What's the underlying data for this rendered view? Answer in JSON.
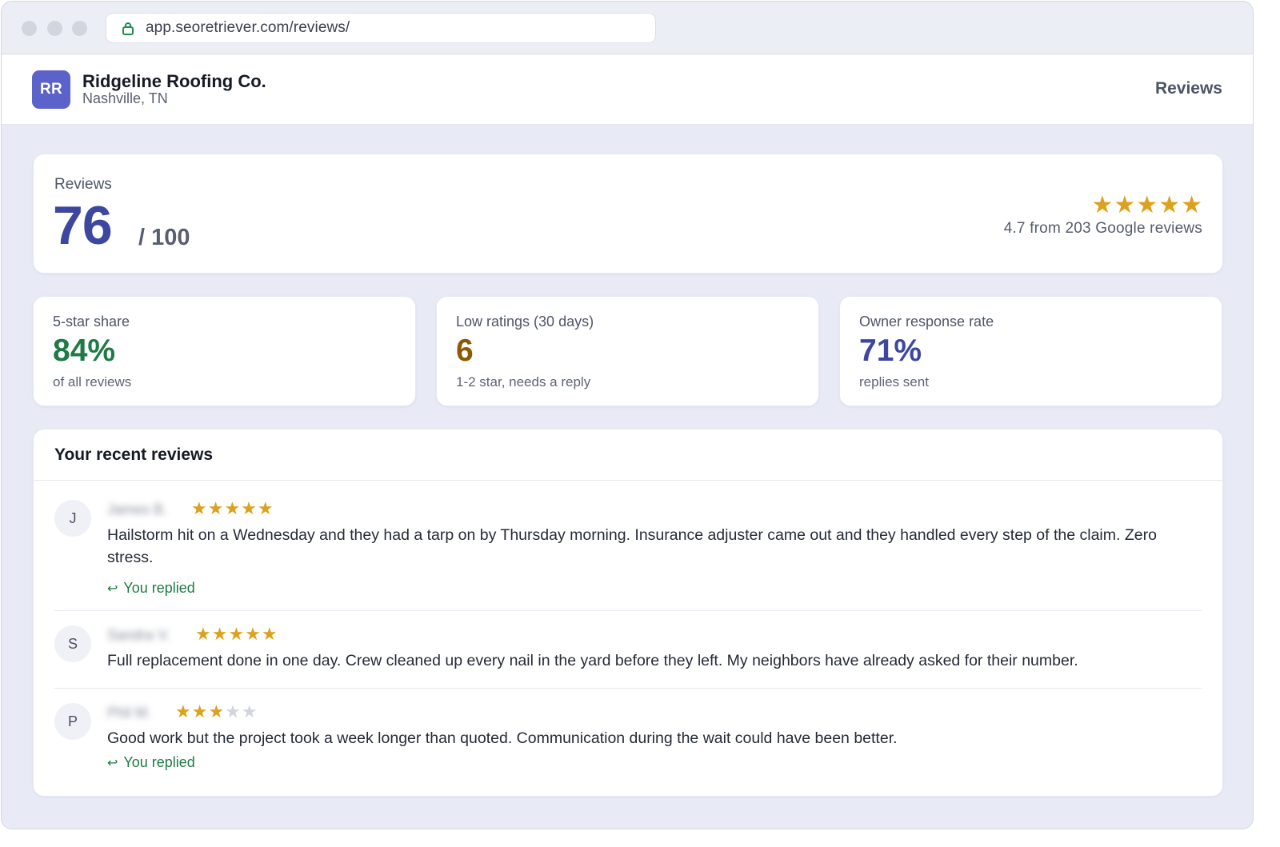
{
  "browser": {
    "url": "app.seoretriever.com/reviews/"
  },
  "header": {
    "logo_initials": "RR",
    "business_name": "Ridgeline Roofing Co.",
    "location": "Nashville, TN",
    "nav_label": "Reviews"
  },
  "score": {
    "label": "Reviews",
    "value": "76",
    "max": "/ 100",
    "stars": "★★★★★",
    "rating_text": "4.7 from 203 Google reviews"
  },
  "stats": [
    {
      "label": "5-star share",
      "value": "84%",
      "sub": "of all reviews"
    },
    {
      "label": "Low ratings (30 days)",
      "value": "6",
      "sub": "1-2 star, needs a reply"
    },
    {
      "label": "Owner response rate",
      "value": "71%",
      "sub": "replies sent"
    }
  ],
  "recent": {
    "title": "Your recent reviews",
    "reply_label": "You replied",
    "items": [
      {
        "initial": "J",
        "name": "James B.",
        "rating": 5,
        "stars_on": "★★★★★",
        "stars_off": "",
        "text": "Hailstorm hit on a Wednesday and they had a tarp on by Thursday morning. Insurance adjuster came out and they handled every step of the claim. Zero stress.",
        "replied": true
      },
      {
        "initial": "S",
        "name": "Sandra V.",
        "rating": 5,
        "stars_on": "★★★★★",
        "stars_off": "",
        "text": "Full replacement done in one day. Crew cleaned up every nail in the yard before they left. My neighbors have already asked for their number.",
        "replied": false
      },
      {
        "initial": "P",
        "name": "Phil M.",
        "rating": 3,
        "stars_on": "★★★",
        "stars_off": "★★",
        "text": "Good work but the project took a week longer than quoted. Communication during the wait could have been better.",
        "replied": true
      }
    ]
  },
  "colors": {
    "accent": "#3d47a0",
    "logo_bg": "#5b62c9",
    "star": "#dca11d",
    "positive": "#1f7a45",
    "warning": "#8a5a06"
  }
}
